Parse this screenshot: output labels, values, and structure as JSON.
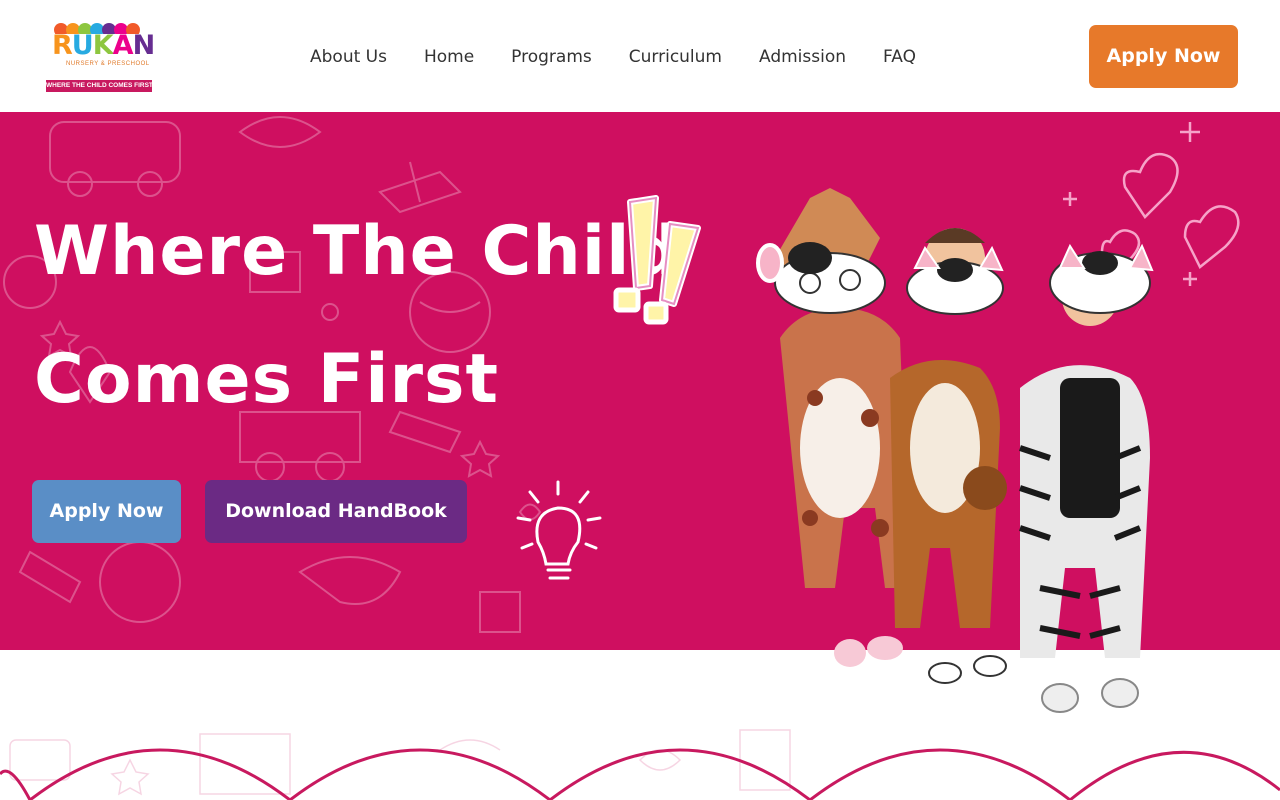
{
  "brand": {
    "logo_text": "RUKAN",
    "logo_subtitle": "NURSERY & PRESCHOOL",
    "logo_tagline": "WHERE THE CHILD COMES FIRST"
  },
  "nav": {
    "items": [
      "About Us",
      "Home",
      "Programs",
      "Curriculum",
      "Admission",
      "FAQ"
    ]
  },
  "header": {
    "apply_label": "Apply Now"
  },
  "hero": {
    "title_line1": "Where The Child",
    "title_line2": "Comes First",
    "apply_label": "Apply Now",
    "handbook_label": "Download HandBook"
  },
  "colors": {
    "hero_bg": "#cf0f60",
    "apply_orange": "#e7792a",
    "apply_blue": "#5a8ec6",
    "handbook_purple": "#6b2a84"
  },
  "icons": [
    "exclamation-sticker-icon",
    "lightbulb-doodle-icon",
    "heart-doodle-icon"
  ]
}
